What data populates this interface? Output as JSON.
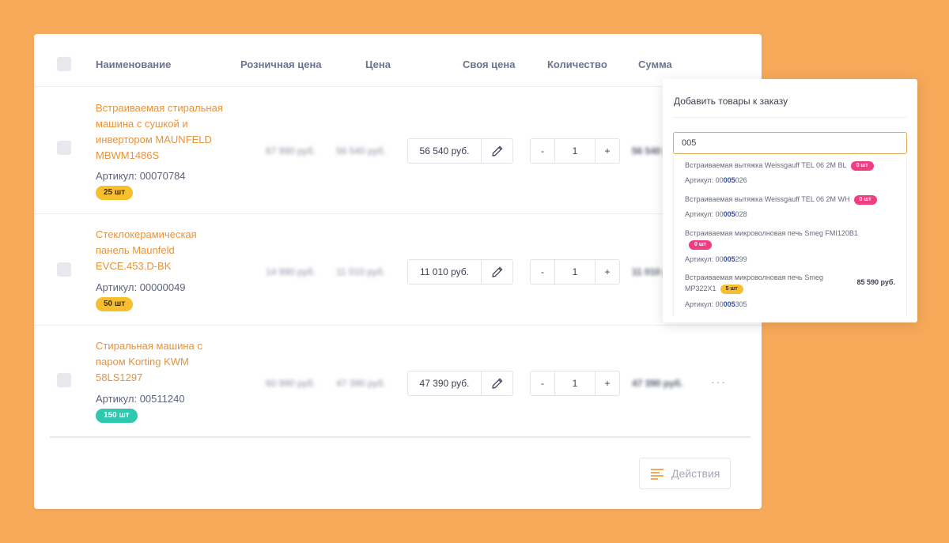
{
  "table": {
    "headers": {
      "name": "Наименование",
      "retail": "Розничная цена",
      "price": "Цена",
      "own_price": "Своя цена",
      "qty": "Количество",
      "sum": "Сумма"
    },
    "rows": [
      {
        "name": "Встраиваемая стиральная машина с сушкой и инвертором MAUNFELD MBWM1486S",
        "sku": "Артикул: 00070784",
        "stock": "25 шт",
        "retail": "67 990 руб.",
        "price": "56 540 руб.",
        "own_price": "56 540 руб.",
        "qty": "1",
        "sum": "56 540 руб."
      },
      {
        "name": "Стеклокерамическая панель Maunfeld EVCE.453.D-BK",
        "sku": "Артикул: 00000049",
        "stock": "50 шт",
        "retail": "14 990 руб.",
        "price": "11 010 руб.",
        "own_price": "11 010 руб.",
        "qty": "1",
        "sum": "11 010 руб."
      },
      {
        "name": "Стиральная машина с паром Korting KWM 58LS1297",
        "sku": "Артикул: 00511240",
        "stock": "150 шт",
        "retail": "60 990 руб.",
        "price": "47 390 руб.",
        "own_price": "47 390 руб.",
        "qty": "1",
        "sum": "47 390 руб."
      }
    ],
    "qty_minus": "-",
    "qty_plus": "+",
    "more": "···"
  },
  "actions": {
    "label": "Действия"
  },
  "popup": {
    "title": "Добавить товары к заказу",
    "search_value": "005",
    "sku_prefix": "Артикул: ",
    "results": [
      {
        "name": "Встраиваемая вытяжка Weissgauff TEL 06 2M BL",
        "stock": "0 шт",
        "sku_before": "00",
        "sku_match": "005",
        "sku_after": "026",
        "price": ""
      },
      {
        "name": "Встраиваемая вытяжка Weissgauff TEL 06 2M WH",
        "stock": "0 шт",
        "sku_before": "00",
        "sku_match": "005",
        "sku_after": "028",
        "price": ""
      },
      {
        "name": "Встраиваемая микроволновая печь Smeg FMI120B1",
        "stock": "0 шт",
        "sku_before": "00",
        "sku_match": "005",
        "sku_after": "299",
        "price": ""
      },
      {
        "name": "Встраиваемая микроволновая печь Smeg MP322X1",
        "stock": "5 шт",
        "sku_before": "00",
        "sku_match": "005",
        "sku_after": "305",
        "price": "85 590 руб."
      }
    ]
  },
  "colors": {
    "background": "#F7A95A",
    "accent": "#E8923A",
    "badge_yellow": "#F7BE2E",
    "badge_teal": "#2EC8B0",
    "badge_pink": "#EF3E82"
  }
}
